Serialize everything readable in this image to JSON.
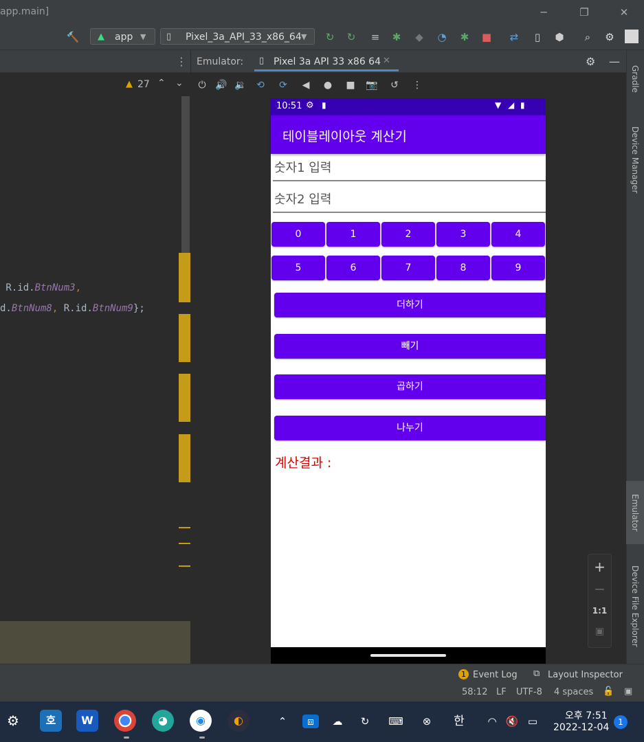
{
  "window": {
    "title": "app.main]",
    "minimize": "─",
    "restore": "❐",
    "close": "✕"
  },
  "toolbar": {
    "module_combo": "app",
    "device_combo": "Pixel_3a_API_33_x86_64"
  },
  "editor": {
    "warning_count": "27",
    "code_line1_prefix": " R.id.",
    "code_line1_id": "BtnNum3",
    "code_line1_suffix": ",",
    "code_line2_prefix": "d.",
    "code_line2_id1": "BtnNum8",
    "code_line2_mid": ", R.id.",
    "code_line2_id2": "BtnNum9",
    "code_line2_suffix": "};"
  },
  "emulator": {
    "label": "Emulator:",
    "tab_label": "Pixel 3a API 33 x86 64",
    "zoom_one_to_one": "1:1"
  },
  "right_strip": {
    "gradle": "Gradle",
    "device_manager": "Device Manager",
    "emulator": "Emulator",
    "device_file_explorer": "Device File Explorer"
  },
  "phone": {
    "status_time": "10:51",
    "app_title": "테이블레이아웃 계산기",
    "input1_hint": "숫자1 입력",
    "input2_hint": "숫자2 입력",
    "digits_row1": [
      "0",
      "1",
      "2",
      "3",
      "4"
    ],
    "digits_row2": [
      "5",
      "6",
      "7",
      "8",
      "9"
    ],
    "add": "더하기",
    "subtract": "빼기",
    "multiply": "곱하기",
    "divide": "나누기",
    "result_label": "계산결과 :"
  },
  "status_bar": {
    "event_log": "Event Log",
    "event_badge": "1",
    "layout_inspector": "Layout Inspector",
    "position": "58:12",
    "line_sep": "LF",
    "encoding": "UTF-8",
    "indent": "4 spaces"
  },
  "taskbar": {
    "ime": "한",
    "time": "오후 7:51",
    "date": "2022-12-04",
    "notification_count": "1"
  },
  "colors": {
    "primary": "#6200ee",
    "primary_dark": "#3700b3",
    "result_text": "#e00000",
    "ide_bg": "#2b2b2b"
  }
}
